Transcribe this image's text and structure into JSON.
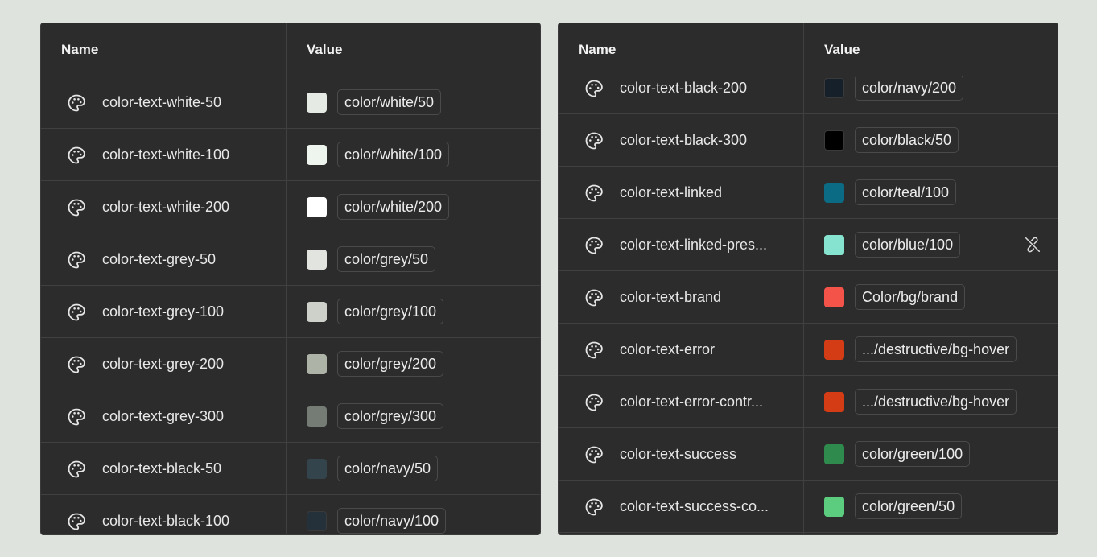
{
  "tables": [
    {
      "header": {
        "name": "Name",
        "value": "Value"
      },
      "rows": [
        {
          "name": "color-text-white-50",
          "value": "color/white/50",
          "swatch": "#e5ebe4"
        },
        {
          "name": "color-text-white-100",
          "value": "color/white/100",
          "swatch": "#eef4ee"
        },
        {
          "name": "color-text-white-200",
          "value": "color/white/200",
          "swatch": "#ffffff"
        },
        {
          "name": "color-text-grey-50",
          "value": "color/grey/50",
          "swatch": "#e2e5df"
        },
        {
          "name": "color-text-grey-100",
          "value": "color/grey/100",
          "swatch": "#cdd1c9"
        },
        {
          "name": "color-text-grey-200",
          "value": "color/grey/200",
          "swatch": "#aeb3a8"
        },
        {
          "name": "color-text-grey-300",
          "value": "color/grey/300",
          "swatch": "#757c76"
        },
        {
          "name": "color-text-black-50",
          "value": "color/navy/50",
          "swatch": "#33444c"
        },
        {
          "name": "color-text-black-100",
          "value": "color/navy/100",
          "swatch": "#24303a"
        }
      ]
    },
    {
      "header": {
        "name": "Name",
        "value": "Value"
      },
      "rows": [
        {
          "name": "color-text-black-200",
          "value": "color/navy/200",
          "swatch": "#16202b"
        },
        {
          "name": "color-text-black-300",
          "value": "color/black/50",
          "swatch": "#000000"
        },
        {
          "name": "color-text-linked",
          "value": "color/teal/100",
          "swatch": "#0b6a84"
        },
        {
          "name": "color-text-linked-pres...",
          "value": "color/blue/100",
          "swatch": "#86e3cf",
          "unlink_icon": true
        },
        {
          "name": "color-text-brand",
          "value": "Color/bg/brand",
          "swatch": "#f4534a"
        },
        {
          "name": "color-text-error",
          "value": ".../destructive/bg-hover",
          "swatch": "#d33c15"
        },
        {
          "name": "color-text-error-contr...",
          "value": ".../destructive/bg-hover",
          "swatch": "#d33c15"
        },
        {
          "name": "color-text-success",
          "value": "color/green/100",
          "swatch": "#2f8a4d"
        },
        {
          "name": "color-text-success-co...",
          "value": "color/green/50",
          "swatch": "#5ccd7f"
        }
      ]
    }
  ],
  "icons": {
    "row_icon": "palette-icon",
    "unlink_icon": "unlink-icon"
  },
  "colors": {
    "background": "#dfe3dd",
    "panel": "#2c2c2c",
    "divider": "#404040",
    "text": "#e8e8e8"
  }
}
